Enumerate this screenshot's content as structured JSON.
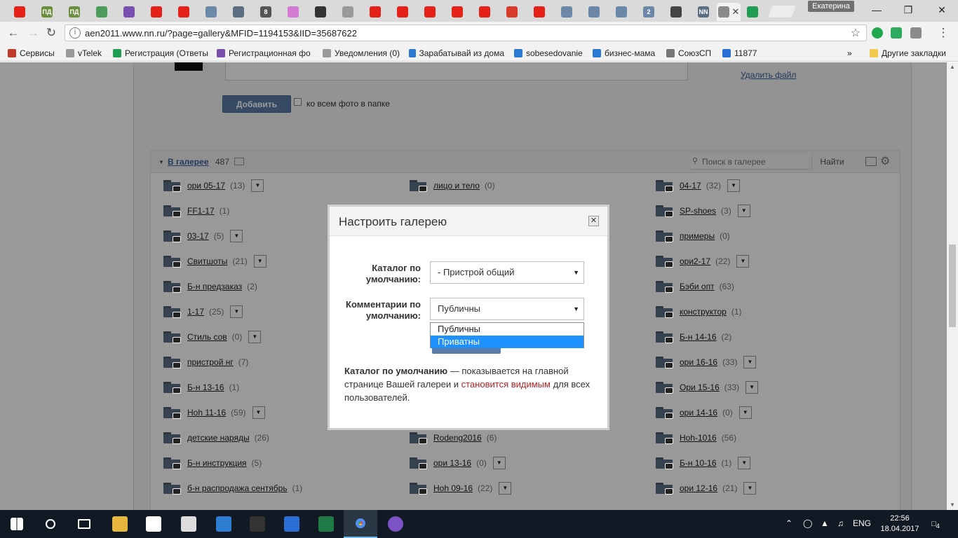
{
  "browser": {
    "profile_name": "Екатерина",
    "tabs": [
      {
        "icon": "youtube-icon",
        "text": "",
        "color": "#e62117"
      },
      {
        "icon": "pd-icon",
        "text": "ПД",
        "color": "#6c8f3d"
      },
      {
        "icon": "pd-icon",
        "text": "ПД",
        "color": "#6c8f3d"
      },
      {
        "icon": "app-icon",
        "text": "",
        "color": "#4a9e5a"
      },
      {
        "icon": "cube-icon",
        "text": "",
        "color": "#7a4fb0"
      },
      {
        "icon": "youtube-icon",
        "text": "",
        "color": "#e62117"
      },
      {
        "icon": "youtube-icon",
        "text": "",
        "color": "#e62117"
      },
      {
        "icon": "telegram-icon",
        "text": "",
        "color": "#6b8aa8"
      },
      {
        "icon": "instagram-icon",
        "text": "",
        "color": "#5d6e82"
      },
      {
        "icon": "site-icon",
        "text": "8",
        "color": "#555555"
      },
      {
        "icon": "flower-icon",
        "text": "",
        "color": "#d47ad4"
      },
      {
        "icon": "headphones-icon",
        "text": "",
        "color": "#333333"
      },
      {
        "icon": "page-icon",
        "text": "",
        "color": "#9a9a9a"
      },
      {
        "icon": "youtube-icon",
        "text": "",
        "color": "#e62117"
      },
      {
        "icon": "youtube-icon",
        "text": "",
        "color": "#e62117"
      },
      {
        "icon": "youtube-icon",
        "text": "",
        "color": "#e62117"
      },
      {
        "icon": "youtube-icon",
        "text": "",
        "color": "#e62117"
      },
      {
        "icon": "youtube-icon",
        "text": "",
        "color": "#e62117"
      },
      {
        "icon": "tag-icon",
        "text": "",
        "color": "#d93b2b"
      },
      {
        "icon": "youtube-icon",
        "text": "",
        "color": "#e62117"
      },
      {
        "icon": "vk-icon",
        "text": "",
        "color": "#6b88a8"
      },
      {
        "icon": "vk-icon",
        "text": "",
        "color": "#6b88a8"
      },
      {
        "icon": "vk-icon",
        "text": "",
        "color": "#6b88a8"
      },
      {
        "icon": "two-icon",
        "text": "2",
        "color": "#6b88a8"
      },
      {
        "icon": "circle-icon",
        "text": "",
        "color": "#444444"
      },
      {
        "icon": "nn-icon",
        "text": "NN",
        "color": "#5d6e82"
      },
      {
        "icon": "active-tab-icon",
        "text": "",
        "color": "#8a8a8a"
      },
      {
        "icon": "sheets-icon",
        "text": "",
        "color": "#1f9d55"
      }
    ],
    "url": "aen2011.www.nn.ru/?page=gallery&MFID=1194153&IID=35687622",
    "bookmarks": [
      {
        "label": "Сервисы",
        "color": "#c0392b"
      },
      {
        "label": "vTelek",
        "color": "#9a9a9a"
      },
      {
        "label": "Регистрация (Ответы",
        "color": "#1f9d55"
      },
      {
        "label": "Регистрационная фо",
        "color": "#7a4fb0"
      },
      {
        "label": "Уведомления (0)",
        "color": "#9a9a9a"
      },
      {
        "label": "Зарабатывай из дома",
        "color": "#2a7ad4"
      },
      {
        "label": "sobesedovanie",
        "color": "#2a7ad4"
      },
      {
        "label": "бизнес-мама",
        "color": "#2a7ad4"
      },
      {
        "label": "СоюзСП",
        "color": "#777777"
      },
      {
        "label": "11877",
        "color": "#2a6fd4"
      }
    ],
    "bookmarks_more": "»",
    "other_bookmarks": "Другие закладки"
  },
  "page": {
    "delete_file": "Удалить файл",
    "add_button": "Добавить",
    "all_photos_label": "ко всем фото в папке",
    "gallery": {
      "title": "В галерее",
      "count": "487",
      "search_placeholder": "Поиск в галерее",
      "find_button": "Найти"
    },
    "folders": [
      [
        {
          "name": "ори 05-17",
          "count": "(13)",
          "menu": true
        },
        {
          "name": "FF1-17",
          "count": "(1)",
          "menu": false
        },
        {
          "name": "03-17",
          "count": "(5)",
          "menu": true
        },
        {
          "name": "Свитшоты",
          "count": "(21)",
          "menu": true
        },
        {
          "name": "Б-н предзаказ",
          "count": "(2)",
          "menu": false
        },
        {
          "name": "1-17",
          "count": "(25)",
          "menu": true
        },
        {
          "name": "Стиль сов",
          "count": "(0)",
          "menu": true
        },
        {
          "name": "пристрой нг",
          "count": "(7)",
          "menu": false
        },
        {
          "name": "Б-н 13-16",
          "count": "(1)",
          "menu": false
        },
        {
          "name": "Hoh 11-16",
          "count": "(59)",
          "menu": true
        },
        {
          "name": "детские наряды",
          "count": "(26)",
          "menu": false
        },
        {
          "name": "Б-н инструкция",
          "count": "(5)",
          "menu": false
        },
        {
          "name": "б-н распродажа сентябрь",
          "count": "(1)",
          "menu": false
        }
      ],
      [
        {
          "name": "лицо и тело",
          "count": "(0)",
          "menu": false
        },
        {
          "name": "Rodeng2016",
          "count": "(6)",
          "menu": false
        },
        {
          "name": "ори 13-16",
          "count": "(0)",
          "menu": true
        },
        {
          "name": "Hoh 09-16",
          "count": "(22)",
          "menu": true
        }
      ],
      [
        {
          "name": "04-17",
          "count": "(32)",
          "menu": true
        },
        {
          "name": "SP-shoes",
          "count": "(3)",
          "menu": true
        },
        {
          "name": "примеры",
          "count": "(0)",
          "menu": false
        },
        {
          "name": "ори2-17",
          "count": "(22)",
          "menu": true
        },
        {
          "name": "Бэби опт",
          "count": "(63)",
          "menu": false
        },
        {
          "name": "конструктор",
          "count": "(1)",
          "menu": false
        },
        {
          "name": "Б-н 14-16",
          "count": "(2)",
          "menu": false
        },
        {
          "name": "ори 16-16",
          "count": "(33)",
          "menu": true
        },
        {
          "name": "Ори 15-16",
          "count": "(33)",
          "menu": true
        },
        {
          "name": "ори 14-16",
          "count": "(0)",
          "menu": true
        },
        {
          "name": "Hoh-1016",
          "count": "(56)",
          "menu": false
        },
        {
          "name": "Б-н 10-16",
          "count": "(1)",
          "menu": true
        },
        {
          "name": "ори 12-16",
          "count": "(21)",
          "menu": true
        }
      ]
    ]
  },
  "dialog": {
    "title": "Настроить галерею",
    "catalog_label": "Каталог по умолчанию:",
    "catalog_value": "- Пристрой общий",
    "comments_label": "Комментарии по умолчанию:",
    "comments_value": "Публичны",
    "options": [
      "Публичны",
      "Приватны"
    ],
    "selected_option": "Приватны",
    "note_bold": "Каталог по умолчанию",
    "note_text1": " — показывается на главной странице Вашей галереи и ",
    "note_red": "становится видимым",
    "note_text2": " для всех пользователей."
  },
  "taskbar": {
    "language": "ENG",
    "time": "22:56",
    "date": "18.04.2017",
    "notifications": "4",
    "apps": [
      {
        "icon": "windows-start-icon",
        "color": "#ffffff"
      },
      {
        "icon": "search-icon",
        "color": "#ffffff"
      },
      {
        "icon": "task-view-icon",
        "color": "#ffffff"
      },
      {
        "icon": "file-explorer-icon",
        "color": "#e8b53d"
      },
      {
        "icon": "store-icon",
        "color": "#ffffff"
      },
      {
        "icon": "calculator-icon",
        "color": "#dddddd"
      },
      {
        "icon": "edge-icon",
        "color": "#2d7dd2"
      },
      {
        "icon": "media-icon",
        "color": "#333333"
      },
      {
        "icon": "scanner-icon",
        "color": "#2a6fd4"
      },
      {
        "icon": "excel-icon",
        "color": "#1f7a45"
      },
      {
        "icon": "chrome-icon",
        "color": "#e8453c"
      },
      {
        "icon": "viber-icon",
        "color": "#7b53c7"
      }
    ]
  }
}
